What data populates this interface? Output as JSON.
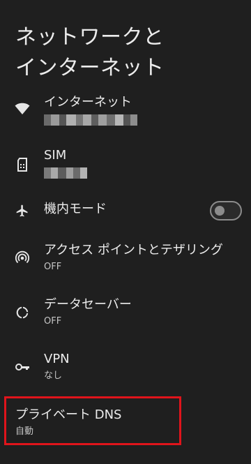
{
  "header": {
    "title_line1": "ネットワークと",
    "title_line2": "インターネット"
  },
  "items": [
    {
      "label": "インターネット",
      "subtitle": "",
      "icon": "wifi-icon"
    },
    {
      "label": "SIM",
      "subtitle": "",
      "icon": "sim-card-icon"
    },
    {
      "label": "機内モード",
      "icon": "airplane-icon",
      "toggle_on": false
    },
    {
      "label": "アクセス ポイントとテザリング",
      "subtitle": "OFF",
      "icon": "hotspot-icon"
    },
    {
      "label": "データセーバー",
      "subtitle": "OFF",
      "icon": "data-saver-icon"
    },
    {
      "label": "VPN",
      "subtitle": "なし",
      "icon": "vpn-key-icon"
    },
    {
      "label": "プライベート DNS",
      "subtitle": "自動",
      "icon": "",
      "highlighted": true
    }
  ],
  "colors": {
    "background": "#1f1f1f",
    "text_primary": "#ececec",
    "text_secondary": "#c6c6c6",
    "highlight_border": "#e0141b",
    "toggle_off": "#8c8c8c"
  }
}
